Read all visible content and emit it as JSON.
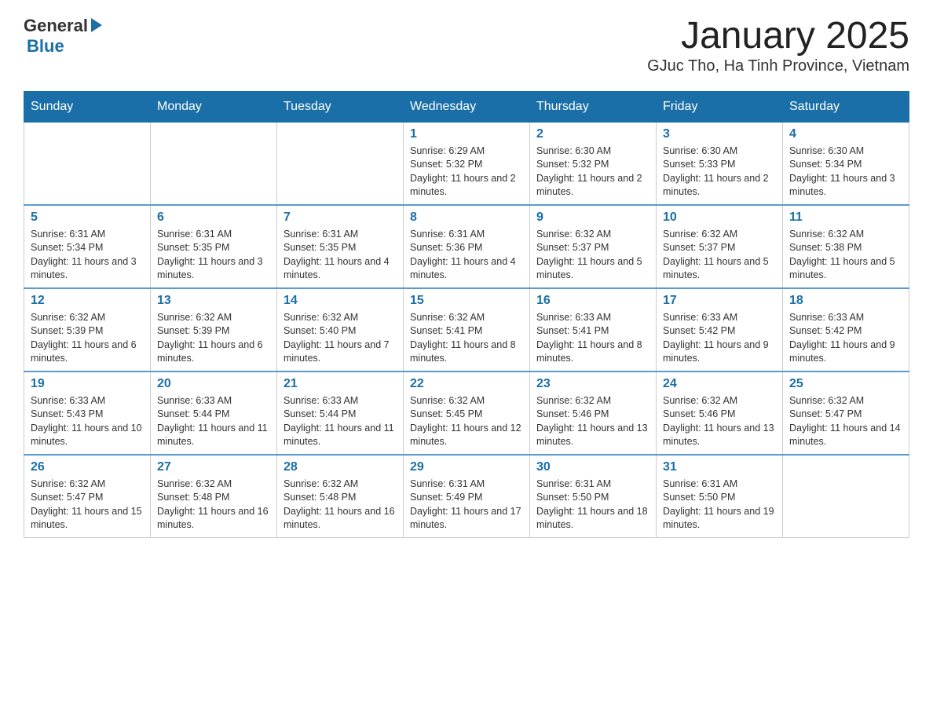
{
  "header": {
    "logo": {
      "general": "General",
      "blue": "Blue"
    },
    "title": "January 2025",
    "subtitle": "GJuc Tho, Ha Tinh Province, Vietnam"
  },
  "calendar": {
    "days": [
      "Sunday",
      "Monday",
      "Tuesday",
      "Wednesday",
      "Thursday",
      "Friday",
      "Saturday"
    ],
    "weeks": [
      [
        {
          "day": "",
          "info": ""
        },
        {
          "day": "",
          "info": ""
        },
        {
          "day": "",
          "info": ""
        },
        {
          "day": "1",
          "info": "Sunrise: 6:29 AM\nSunset: 5:32 PM\nDaylight: 11 hours and 2 minutes."
        },
        {
          "day": "2",
          "info": "Sunrise: 6:30 AM\nSunset: 5:32 PM\nDaylight: 11 hours and 2 minutes."
        },
        {
          "day": "3",
          "info": "Sunrise: 6:30 AM\nSunset: 5:33 PM\nDaylight: 11 hours and 2 minutes."
        },
        {
          "day": "4",
          "info": "Sunrise: 6:30 AM\nSunset: 5:34 PM\nDaylight: 11 hours and 3 minutes."
        }
      ],
      [
        {
          "day": "5",
          "info": "Sunrise: 6:31 AM\nSunset: 5:34 PM\nDaylight: 11 hours and 3 minutes."
        },
        {
          "day": "6",
          "info": "Sunrise: 6:31 AM\nSunset: 5:35 PM\nDaylight: 11 hours and 3 minutes."
        },
        {
          "day": "7",
          "info": "Sunrise: 6:31 AM\nSunset: 5:35 PM\nDaylight: 11 hours and 4 minutes."
        },
        {
          "day": "8",
          "info": "Sunrise: 6:31 AM\nSunset: 5:36 PM\nDaylight: 11 hours and 4 minutes."
        },
        {
          "day": "9",
          "info": "Sunrise: 6:32 AM\nSunset: 5:37 PM\nDaylight: 11 hours and 5 minutes."
        },
        {
          "day": "10",
          "info": "Sunrise: 6:32 AM\nSunset: 5:37 PM\nDaylight: 11 hours and 5 minutes."
        },
        {
          "day": "11",
          "info": "Sunrise: 6:32 AM\nSunset: 5:38 PM\nDaylight: 11 hours and 5 minutes."
        }
      ],
      [
        {
          "day": "12",
          "info": "Sunrise: 6:32 AM\nSunset: 5:39 PM\nDaylight: 11 hours and 6 minutes."
        },
        {
          "day": "13",
          "info": "Sunrise: 6:32 AM\nSunset: 5:39 PM\nDaylight: 11 hours and 6 minutes."
        },
        {
          "day": "14",
          "info": "Sunrise: 6:32 AM\nSunset: 5:40 PM\nDaylight: 11 hours and 7 minutes."
        },
        {
          "day": "15",
          "info": "Sunrise: 6:32 AM\nSunset: 5:41 PM\nDaylight: 11 hours and 8 minutes."
        },
        {
          "day": "16",
          "info": "Sunrise: 6:33 AM\nSunset: 5:41 PM\nDaylight: 11 hours and 8 minutes."
        },
        {
          "day": "17",
          "info": "Sunrise: 6:33 AM\nSunset: 5:42 PM\nDaylight: 11 hours and 9 minutes."
        },
        {
          "day": "18",
          "info": "Sunrise: 6:33 AM\nSunset: 5:42 PM\nDaylight: 11 hours and 9 minutes."
        }
      ],
      [
        {
          "day": "19",
          "info": "Sunrise: 6:33 AM\nSunset: 5:43 PM\nDaylight: 11 hours and 10 minutes."
        },
        {
          "day": "20",
          "info": "Sunrise: 6:33 AM\nSunset: 5:44 PM\nDaylight: 11 hours and 11 minutes."
        },
        {
          "day": "21",
          "info": "Sunrise: 6:33 AM\nSunset: 5:44 PM\nDaylight: 11 hours and 11 minutes."
        },
        {
          "day": "22",
          "info": "Sunrise: 6:32 AM\nSunset: 5:45 PM\nDaylight: 11 hours and 12 minutes."
        },
        {
          "day": "23",
          "info": "Sunrise: 6:32 AM\nSunset: 5:46 PM\nDaylight: 11 hours and 13 minutes."
        },
        {
          "day": "24",
          "info": "Sunrise: 6:32 AM\nSunset: 5:46 PM\nDaylight: 11 hours and 13 minutes."
        },
        {
          "day": "25",
          "info": "Sunrise: 6:32 AM\nSunset: 5:47 PM\nDaylight: 11 hours and 14 minutes."
        }
      ],
      [
        {
          "day": "26",
          "info": "Sunrise: 6:32 AM\nSunset: 5:47 PM\nDaylight: 11 hours and 15 minutes."
        },
        {
          "day": "27",
          "info": "Sunrise: 6:32 AM\nSunset: 5:48 PM\nDaylight: 11 hours and 16 minutes."
        },
        {
          "day": "28",
          "info": "Sunrise: 6:32 AM\nSunset: 5:48 PM\nDaylight: 11 hours and 16 minutes."
        },
        {
          "day": "29",
          "info": "Sunrise: 6:31 AM\nSunset: 5:49 PM\nDaylight: 11 hours and 17 minutes."
        },
        {
          "day": "30",
          "info": "Sunrise: 6:31 AM\nSunset: 5:50 PM\nDaylight: 11 hours and 18 minutes."
        },
        {
          "day": "31",
          "info": "Sunrise: 6:31 AM\nSunset: 5:50 PM\nDaylight: 11 hours and 19 minutes."
        },
        {
          "day": "",
          "info": ""
        }
      ]
    ]
  }
}
